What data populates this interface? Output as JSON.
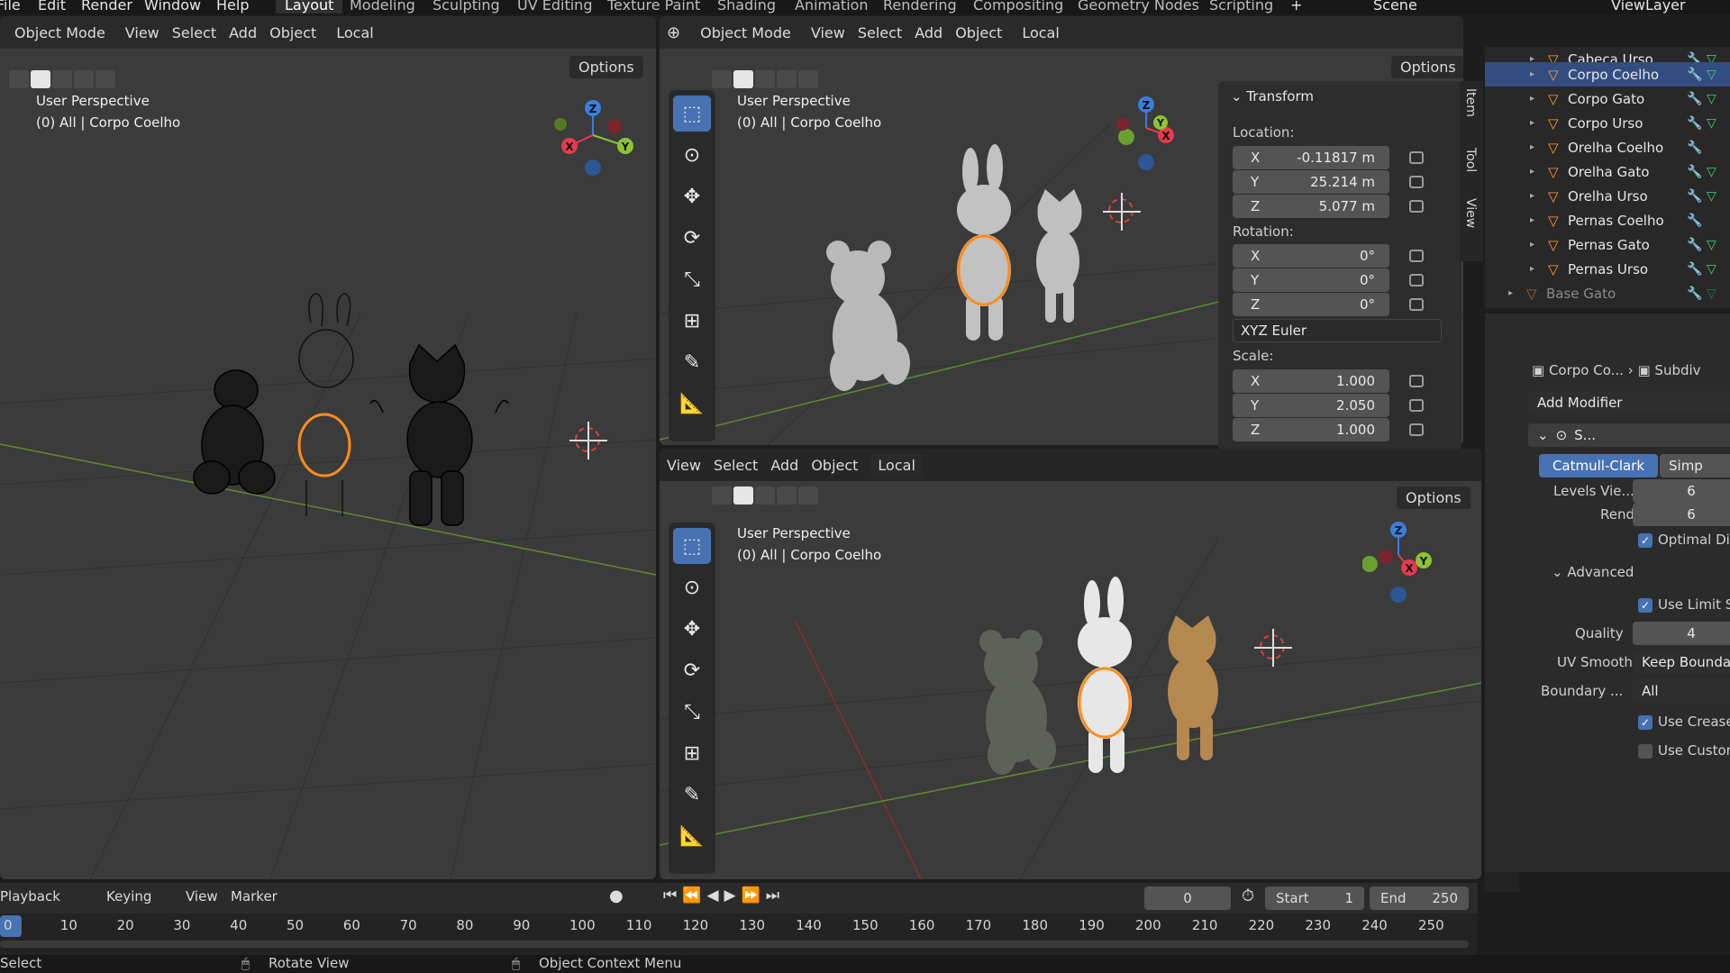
{
  "menu": {
    "items": [
      "File",
      "Edit",
      "Render",
      "Window",
      "Help"
    ],
    "workspaces": [
      "Layout",
      "Modeling",
      "Sculpting",
      "UV Editing",
      "Texture Paint",
      "Shading",
      "Animation",
      "Rendering",
      "Compositing",
      "Geometry Nodes",
      "Scripting"
    ],
    "active_workspace": "Layout",
    "scene": "Scene",
    "view_layer": "ViewLayer"
  },
  "viewport_header": {
    "mode": "Object Mode",
    "menus": [
      "View",
      "Select",
      "Add",
      "Object"
    ],
    "orientation": "Local",
    "options": "Options"
  },
  "viewport_info": {
    "perspective": "User Perspective",
    "collection": "(0) All | Corpo Coelho"
  },
  "axis": {
    "x": "X",
    "y": "Y",
    "z": "Z"
  },
  "side_tabs": [
    "Item",
    "Tool",
    "View"
  ],
  "transform": {
    "title": "Transform",
    "location_label": "Location:",
    "location": [
      {
        "axis": "X",
        "value": "-0.11817 m"
      },
      {
        "axis": "Y",
        "value": "25.214 m"
      },
      {
        "axis": "Z",
        "value": "5.077 m"
      }
    ],
    "rotation_label": "Rotation:",
    "rotation": [
      {
        "axis": "X",
        "value": "0°"
      },
      {
        "axis": "Y",
        "value": "0°"
      },
      {
        "axis": "Z",
        "value": "0°"
      }
    ],
    "rotation_mode": "XYZ Euler",
    "scale_label": "Scale:",
    "scale": [
      {
        "axis": "X",
        "value": "1.000"
      },
      {
        "axis": "Y",
        "value": "2.050"
      },
      {
        "axis": "Z",
        "value": "1.000"
      }
    ]
  },
  "outliner": {
    "rows": [
      {
        "name": "Cabeca Urso",
        "selected": false
      },
      {
        "name": "Corpo Coelho",
        "selected": true
      },
      {
        "name": "Corpo Gato",
        "selected": false
      },
      {
        "name": "Corpo Urso",
        "selected": false
      },
      {
        "name": "Orelha Coelho",
        "selected": false
      },
      {
        "name": "Orelha Gato",
        "selected": false
      },
      {
        "name": "Orelha Urso",
        "selected": false
      },
      {
        "name": "Pernas Coelho",
        "selected": false
      },
      {
        "name": "Pernas Gato",
        "selected": false
      },
      {
        "name": "Pernas Urso",
        "selected": false
      }
    ],
    "base_row": "Base Gato"
  },
  "properties": {
    "breadcrumb_object": "Corpo Co...",
    "breadcrumb_modifier": "Subdiv",
    "add_modifier": "Add Modifier",
    "modifier_short_name": "S...",
    "type_catmull": "Catmull-Clark",
    "type_simple": "Simp",
    "levels_viewport_label": "Levels Vie...",
    "levels_viewport": "6",
    "render_label": "Render",
    "render_levels": "6",
    "optimal_display": "Optimal Disp",
    "advanced": "Advanced",
    "use_limit": "Use Limit Su",
    "quality_label": "Quality",
    "quality": "4",
    "uv_smooth_label": "UV Smooth",
    "uv_smooth": "Keep Bounda",
    "boundary_label": "Boundary ...",
    "boundary": "All",
    "use_creases": "Use Creases",
    "use_custom": "Use Custom"
  },
  "timeline": {
    "menus": [
      "Playback",
      "Keying",
      "View",
      "Marker"
    ],
    "current_frame": "0",
    "start_label": "Start",
    "start": "1",
    "end_label": "End",
    "end": "250",
    "ticks": [
      "0",
      "10",
      "20",
      "30",
      "40",
      "50",
      "60",
      "70",
      "80",
      "90",
      "100",
      "110",
      "120",
      "130",
      "140",
      "150",
      "160",
      "170",
      "180",
      "190",
      "200",
      "210",
      "220",
      "230",
      "240",
      "250"
    ]
  },
  "statusbar": {
    "select": "Select",
    "rotate": "Rotate View",
    "context": "Object Context Menu"
  },
  "colors": {
    "selection_blue": "#4772b3",
    "outliner_selected": "#334d80",
    "object_orange": "#ff9a30",
    "axis_x": "#e83a4e",
    "axis_y": "#8bc531",
    "axis_z": "#3a7ee0"
  }
}
